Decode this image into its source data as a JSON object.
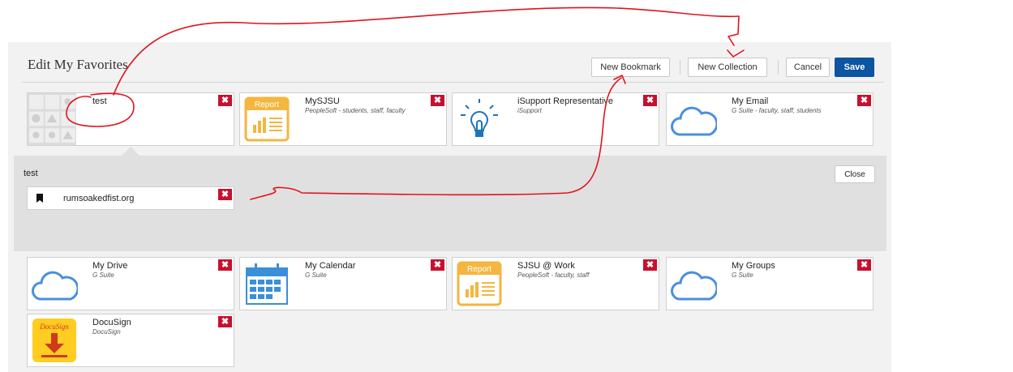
{
  "header": {
    "title": "Edit My Favorites",
    "new_bookmark": "New Bookmark",
    "new_collection": "New Collection",
    "cancel": "Cancel",
    "save": "Save"
  },
  "delete_glyph": "✖",
  "tiles_top": [
    {
      "title": "test",
      "subtitle": "",
      "icon": "collection-grid-icon"
    },
    {
      "title": "MySJSU",
      "subtitle": "PeopleSoft - students, staff, faculty",
      "icon": "report-icon"
    },
    {
      "title": "iSupport Representative",
      "subtitle": "iSupport",
      "icon": "lightbulb-icon"
    },
    {
      "title": "My Email",
      "subtitle": "G Suite - faculty, staff, students",
      "icon": "cloud-icon"
    }
  ],
  "collection": {
    "title": "test",
    "close": "Close",
    "bookmarks": [
      {
        "label": "rumsoakedfist.org",
        "icon": "bookmark-icon"
      }
    ]
  },
  "tiles_bottom": [
    {
      "title": "My Drive",
      "subtitle": "G Suite",
      "icon": "cloud-icon"
    },
    {
      "title": "My Calendar",
      "subtitle": "G Suite",
      "icon": "calendar-icon"
    },
    {
      "title": "SJSU @ Work",
      "subtitle": "PeopleSoft - faculty, staff",
      "icon": "report-icon"
    },
    {
      "title": "My Groups",
      "subtitle": "G Suite",
      "icon": "cloud-icon"
    },
    {
      "title": "DocuSign",
      "subtitle": "DocuSign",
      "icon": "docusign-icon"
    }
  ],
  "icon_text": {
    "report": "Report",
    "docusign": "DocuSign"
  },
  "colors": {
    "save": "#0c55a0",
    "delete": "#c8102e",
    "annotation": "#e0141e",
    "report": "#f4b63f",
    "cloud": "#4a8fe0"
  }
}
